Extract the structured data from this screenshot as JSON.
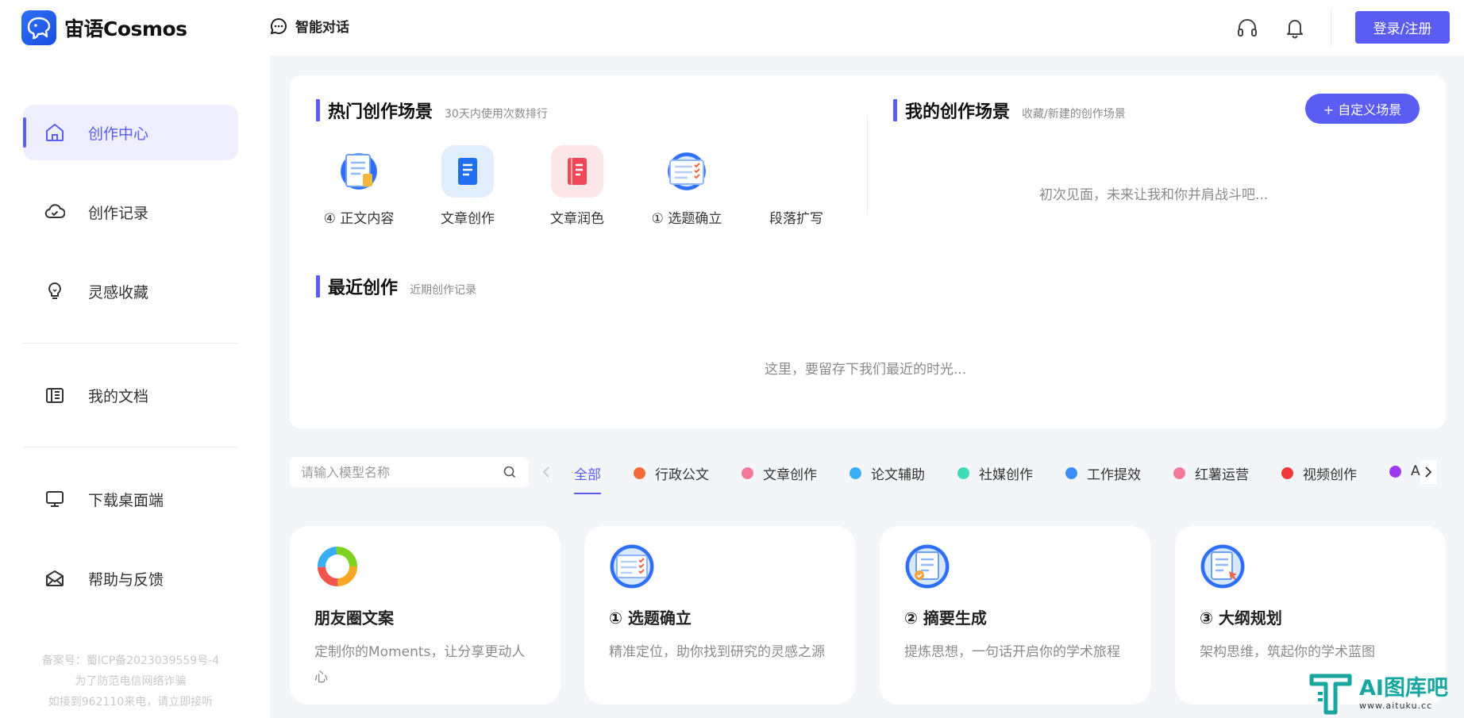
{
  "header": {
    "brand": "宙语Cosmos",
    "nav_chat": "智能对话",
    "login_label": "登录/注册"
  },
  "sidebar": {
    "items": [
      {
        "label": "创作中心",
        "icon": "home-icon"
      },
      {
        "label": "创作记录",
        "icon": "cloud-check-icon"
      },
      {
        "label": "灵感收藏",
        "icon": "lightbulb-icon"
      },
      {
        "label": "我的文档",
        "icon": "book-icon"
      },
      {
        "label": "下载桌面端",
        "icon": "monitor-icon"
      },
      {
        "label": "帮助与反馈",
        "icon": "mail-icon"
      }
    ],
    "footer": [
      "备案号：蜀ICP备2023039559号-4",
      "为了防范电信网络诈骗",
      "如接到962110来电，请立即接听"
    ]
  },
  "hot": {
    "title": "热门创作场景",
    "subtitle": "30天内使用次数排行",
    "scenes": [
      {
        "label": "④ 正文内容"
      },
      {
        "label": "文章创作"
      },
      {
        "label": "文章润色"
      },
      {
        "label": "① 选题确立"
      },
      {
        "label": "段落扩写"
      }
    ]
  },
  "mine": {
    "title": "我的创作场景",
    "subtitle": "收藏/新建的创作场景",
    "custom_btn": "+ 自定义场景",
    "empty": "初次见面，未来让我和你并肩战斗吧..."
  },
  "recent": {
    "title": "最近创作",
    "subtitle": "近期创作记录",
    "empty": "这里，要留存下我们最近的时光..."
  },
  "filter": {
    "search_placeholder": "请输入模型名称",
    "tabs": [
      {
        "label": "全部",
        "color": ""
      },
      {
        "label": "行政公文",
        "color": "#f46b3a"
      },
      {
        "label": "文章创作",
        "color": "#f57a9a"
      },
      {
        "label": "论文辅助",
        "color": "#3aaef5"
      },
      {
        "label": "社媒创作",
        "color": "#3ddbb6"
      },
      {
        "label": "工作提效",
        "color": "#3a8ef5"
      },
      {
        "label": "红薯运营",
        "color": "#f57a9a"
      },
      {
        "label": "视频创作",
        "color": "#f03a3a"
      },
      {
        "label": "AI",
        "color": "#9c3af0"
      }
    ]
  },
  "cards": [
    {
      "title": "朋友圈文案",
      "desc": "定制你的Moments，让分享更动人心"
    },
    {
      "title": "① 选题确立",
      "desc": "精准定位，助你找到研究的灵感之源"
    },
    {
      "title": "② 摘要生成",
      "desc": "提炼思想，一句话开启你的学术旅程"
    },
    {
      "title": "③ 大纲规划",
      "desc": "架构思维，筑起你的学术蓝图"
    }
  ],
  "watermark": {
    "main": "AI图库吧",
    "sub": "www.aituku.cc"
  }
}
